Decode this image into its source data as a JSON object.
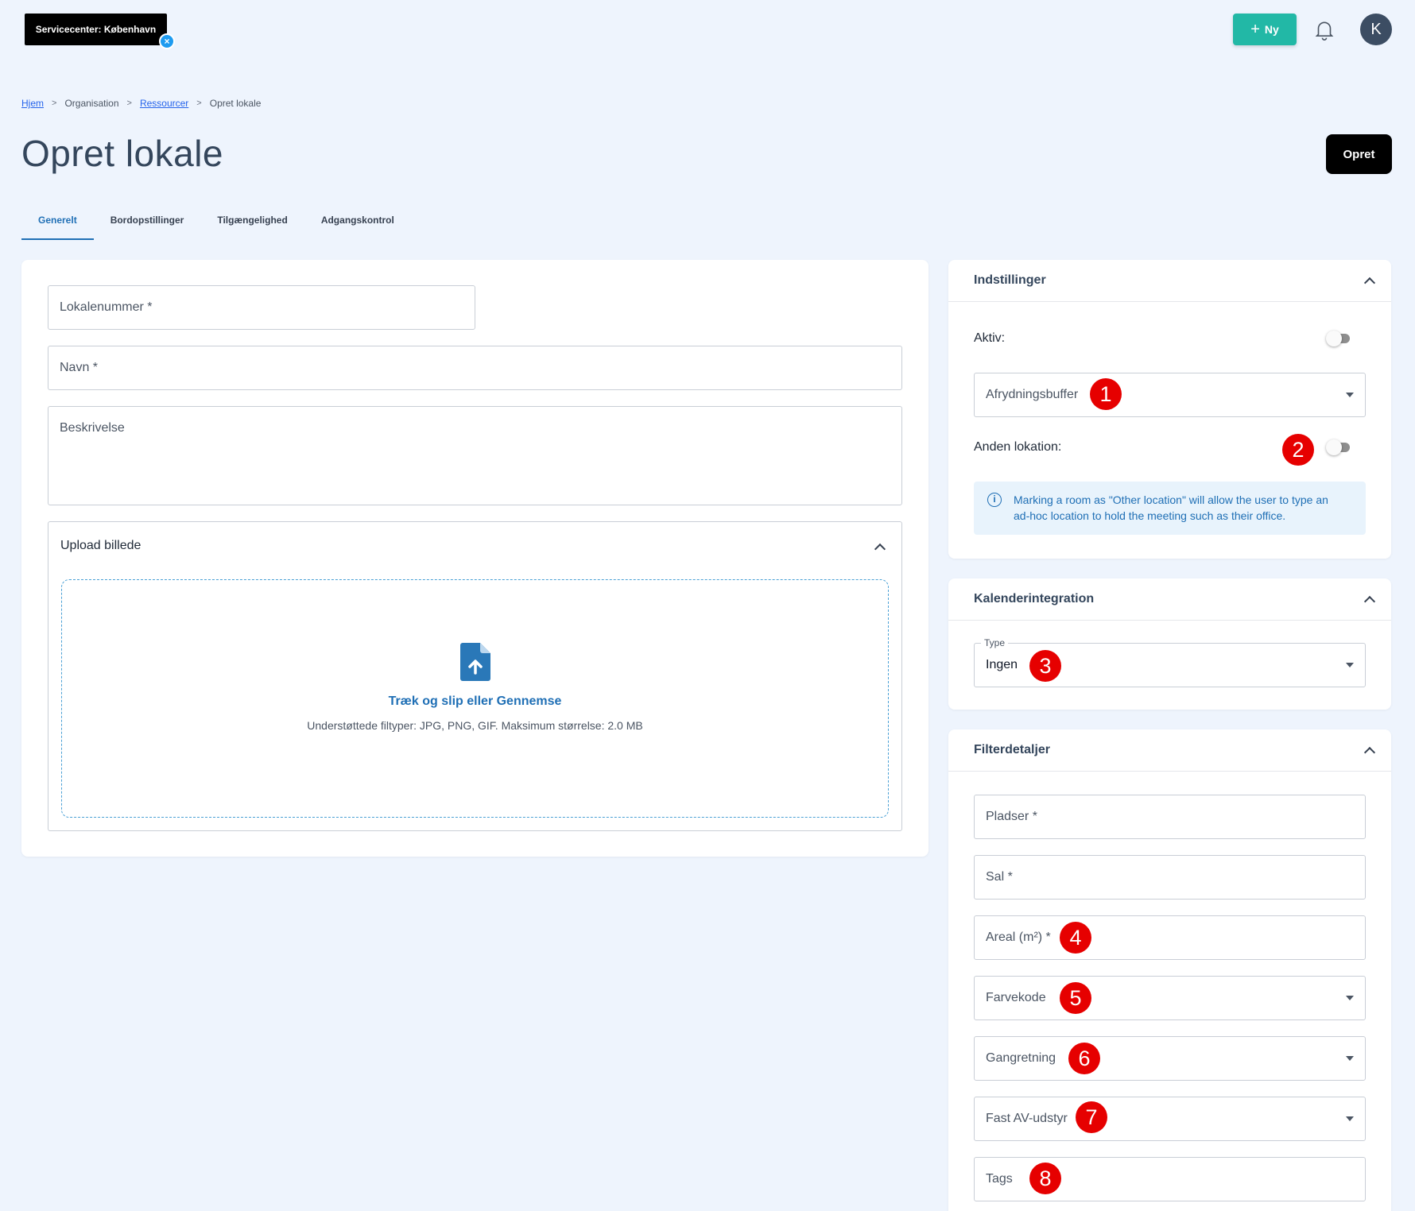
{
  "topbar": {
    "service_center": "Servicecenter: København",
    "new_button": "Ny",
    "avatar_initial": "K"
  },
  "breadcrumb": [
    "Hjem",
    "Organisation",
    "Ressourcer",
    "Opret lokale"
  ],
  "page": {
    "title": "Opret lokale",
    "create_button": "Opret"
  },
  "tabs": [
    "Generelt",
    "Bordopstillinger",
    "Tilgængelighed",
    "Adgangskontrol"
  ],
  "general": {
    "room_number": "Lokalenummer *",
    "name": "Navn *",
    "description": "Beskrivelse",
    "upload_title": "Upload billede",
    "drop_text": "Træk og slip eller Gennemse",
    "drop_sub": "Understøttede filtyper: JPG, PNG, GIF. Maksimum størrelse: 2.0 MB"
  },
  "settings": {
    "title": "Indstillinger",
    "active_label": "Aktiv:",
    "active_value": false,
    "cleanup_buffer": "Afrydningsbuffer",
    "other_location_label": "Anden lokation:",
    "other_location_value": false,
    "info_text": "Marking a room as \"Other location\" will allow the user to type an ad-hoc location to hold the meeting such as their office."
  },
  "calendar": {
    "title": "Kalenderintegration",
    "type_label": "Type",
    "type_value": "Ingen"
  },
  "filters": {
    "title": "Filterdetaljer",
    "seats": "Pladser *",
    "hall": "Sal *",
    "area": "Areal (m²) *",
    "color_code": "Farvekode",
    "walking_direction": "Gangretning",
    "av_equipment": "Fast AV-udstyr",
    "tags": "Tags"
  },
  "markers": [
    "1",
    "2",
    "3",
    "4",
    "5",
    "6",
    "7",
    "8"
  ],
  "colors": {
    "accent": "#1f6fb5",
    "new_button": "#22b8a6",
    "marker": "#e60000",
    "background": "#eef4fd"
  }
}
